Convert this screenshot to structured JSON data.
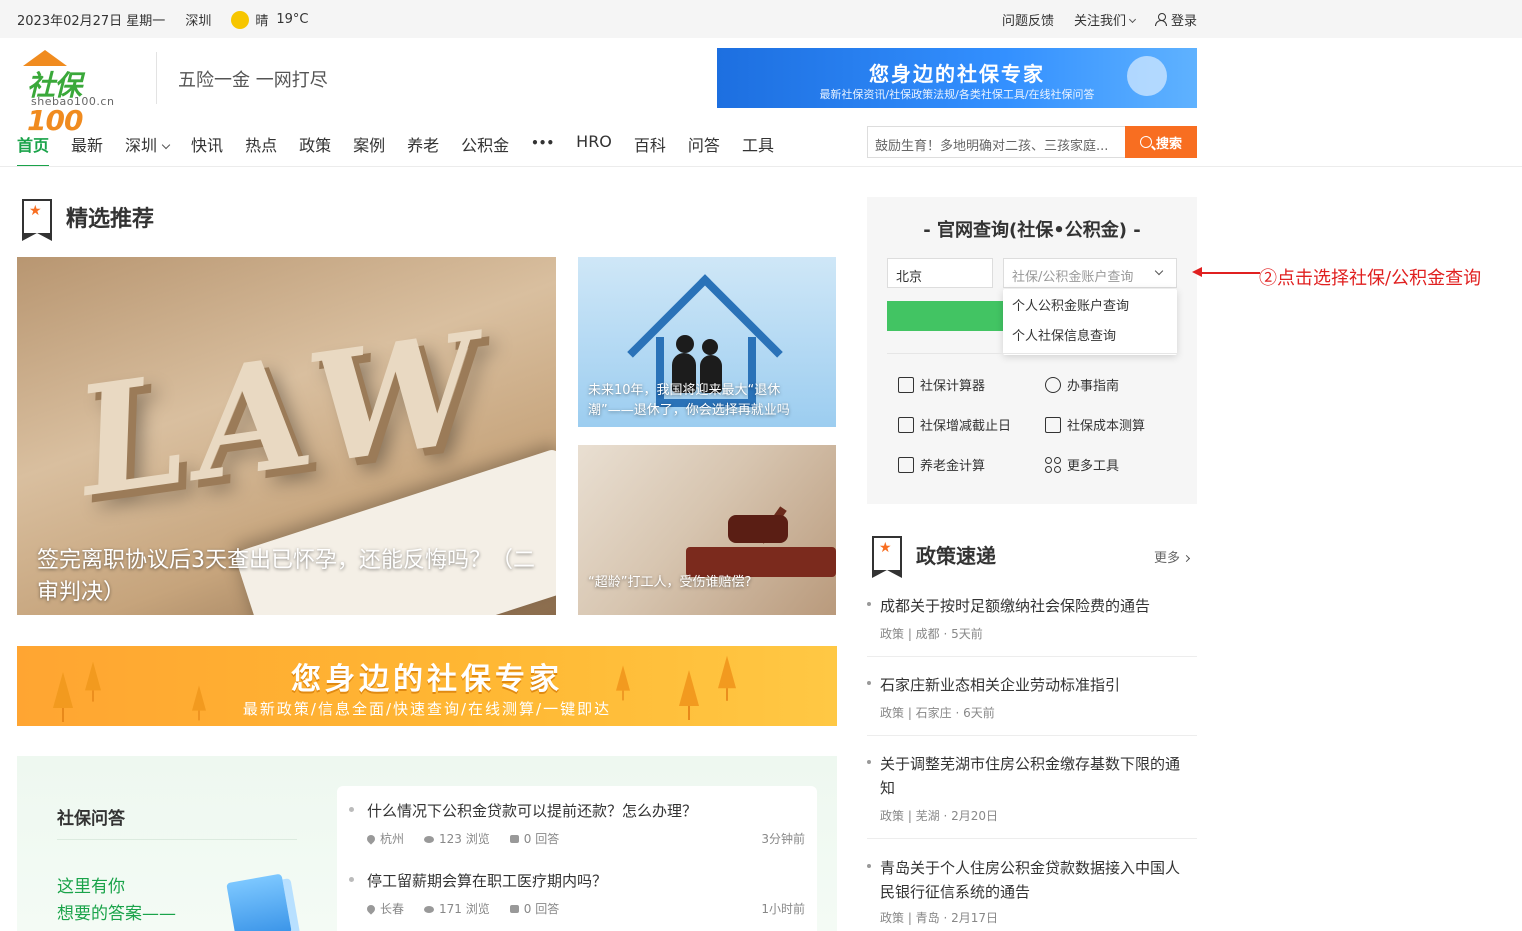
{
  "topbar": {
    "date": "2023年02月27日 星期一",
    "city": "深圳",
    "weather": "晴",
    "temp": "19°C",
    "feedback": "问题反馈",
    "follow": "关注我们",
    "login": "登录"
  },
  "header": {
    "logo_text": "社保",
    "logo_num": "100",
    "logo_domain": "shebao100.cn",
    "slogan": "五险一金 一网打尽",
    "banner_title": "您身边的社保专家",
    "banner_sub": "最新社保资讯/社保政策法规/各类社保工具/在线社保问答"
  },
  "nav": {
    "items": [
      "首页",
      "最新",
      "深圳",
      "快讯",
      "热点",
      "政策",
      "案例",
      "养老",
      "公积金",
      "•••",
      "HRO",
      "百科",
      "问答",
      "工具"
    ],
    "search_placeholder": "鼓励生育！多地明确对二孩、三孩家庭...",
    "search_button": "搜索"
  },
  "featured": {
    "heading": "精选推荐",
    "big_caption": "签完离职协议后3天查出已怀孕，还能反悔吗？（二审判决）",
    "big_art": "LAW",
    "small1_caption": "未来10年，我国将迎来最大“退休潮”——退休了，你会选择再就业吗",
    "small2_caption": "“超龄”打工人，受伤谁赔偿?"
  },
  "mid_banner": {
    "title": "您身边的社保专家",
    "subtitle": "最新政策/信息全面/快速查询/在线测算/一键即达"
  },
  "qa": {
    "title": "社保问答",
    "slogan_line1": "这里有你",
    "slogan_line2": "想要的答案——",
    "items": [
      {
        "question": "什么情况下公积金贷款可以提前还款？怎么办理？",
        "city": "杭州",
        "views": "123 浏览",
        "answers": "0 回答",
        "time": "3分钟前"
      },
      {
        "question": "停工留薪期会算在职工医疗期内吗？",
        "city": "长春",
        "views": "171 浏览",
        "answers": "0 回答",
        "time": "1小时前"
      }
    ]
  },
  "query_panel": {
    "title": "- 官网查询(社保•公积金) -",
    "city_value": "北京",
    "type_placeholder": "社保/公积金账户查询",
    "dropdown": [
      "个人公积金账户查询",
      "个人社保信息查询"
    ],
    "tools": [
      "社保计算器",
      "办事指南",
      "社保增减截止日",
      "社保成本测算",
      "养老金计算",
      "更多工具"
    ]
  },
  "annotation": "②点击选择社保/公积金查询",
  "policy": {
    "heading": "政策速递",
    "more": "更多",
    "items": [
      {
        "title": "成都关于按时足额缴纳社会保险费的通告",
        "meta": "政策 | 成都 · 5天前"
      },
      {
        "title": "石家庄新业态相关企业劳动标准指引",
        "meta": "政策 | 石家庄 · 6天前"
      },
      {
        "title": "关于调整芜湖市住房公积金缴存基数下限的通知",
        "meta": "政策 | 芜湖 · 2月20日"
      },
      {
        "title": "青岛关于个人住房公积金贷款数据接入中国人民银行征信系统的通告",
        "meta": "政策 | 青岛 · 2月17日"
      }
    ]
  },
  "colors": {
    "brand_green": "#1aa34a",
    "search_orange": "#f86e21",
    "annotation_red": "#e02020"
  }
}
